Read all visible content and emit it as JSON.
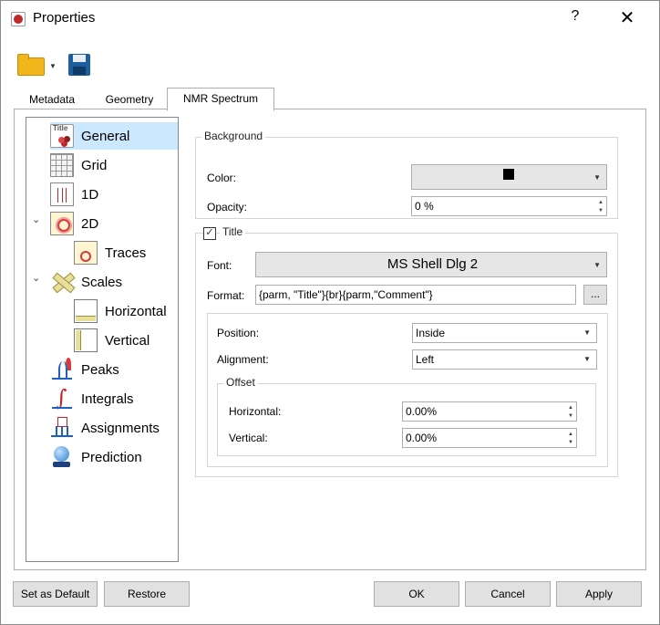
{
  "window": {
    "title": "Properties",
    "help_label": "?",
    "close_label": "✕",
    "app_icon": "app-logo-icon"
  },
  "toolbar": {
    "open_icon": "folder-open-icon",
    "dropdown_icon": "chevron-down-icon",
    "save_icon": "floppy-disk-icon"
  },
  "tabs": [
    {
      "label": "Metadata",
      "active": false
    },
    {
      "label": "Geometry",
      "active": false
    },
    {
      "label": "NMR Spectrum",
      "active": true
    }
  ],
  "tree": {
    "items": [
      {
        "label": "General",
        "icon": "title-icon",
        "selected": true
      },
      {
        "label": "Grid",
        "icon": "grid-icon"
      },
      {
        "label": "1D",
        "icon": "spectrum-1d-icon"
      },
      {
        "label": "2D",
        "icon": "spectrum-2d-icon",
        "expanded": true
      },
      {
        "label": "Traces",
        "icon": "traces-icon"
      },
      {
        "label": "Scales",
        "icon": "scales-icon",
        "expanded": true
      },
      {
        "label": "Horizontal",
        "icon": "horizontal-scale-icon"
      },
      {
        "label": "Vertical",
        "icon": "vertical-scale-icon"
      },
      {
        "label": "Peaks",
        "icon": "peaks-icon"
      },
      {
        "label": "Integrals",
        "icon": "integrals-icon"
      },
      {
        "label": "Assignments",
        "icon": "assignments-icon"
      },
      {
        "label": "Prediction",
        "icon": "prediction-icon"
      }
    ]
  },
  "background": {
    "group_title": "Background",
    "color_label": "Color:",
    "color_value": "#000000",
    "opacity_label": "Opacity:",
    "opacity_value": "0 %"
  },
  "title_group": {
    "group_title": "Title",
    "checked": true,
    "check_mark": "✓",
    "font_label": "Font:",
    "font_value": "MS Shell Dlg 2",
    "format_label": "Format:",
    "format_value": "{parm, \"Title\"}{br}{parm,\"Comment\"}",
    "format_button": "...",
    "position_label": "Position:",
    "position_value": "Inside",
    "alignment_label": "Alignment:",
    "alignment_value": "Left",
    "offset": {
      "group_title": "Offset",
      "horizontal_label": "Horizontal:",
      "horizontal_value": "0.00%",
      "vertical_label": "Vertical:",
      "vertical_value": "0.00%"
    }
  },
  "footer": {
    "set_default": "Set as Default",
    "restore": "Restore",
    "ok": "OK",
    "cancel": "Cancel",
    "apply": "Apply"
  },
  "glyphs": {
    "down_arrow": "▼",
    "up_arrow": "▲",
    "expander_open": "⌄"
  },
  "colors": {
    "selection": "#cce8ff",
    "border": "#adadad"
  }
}
